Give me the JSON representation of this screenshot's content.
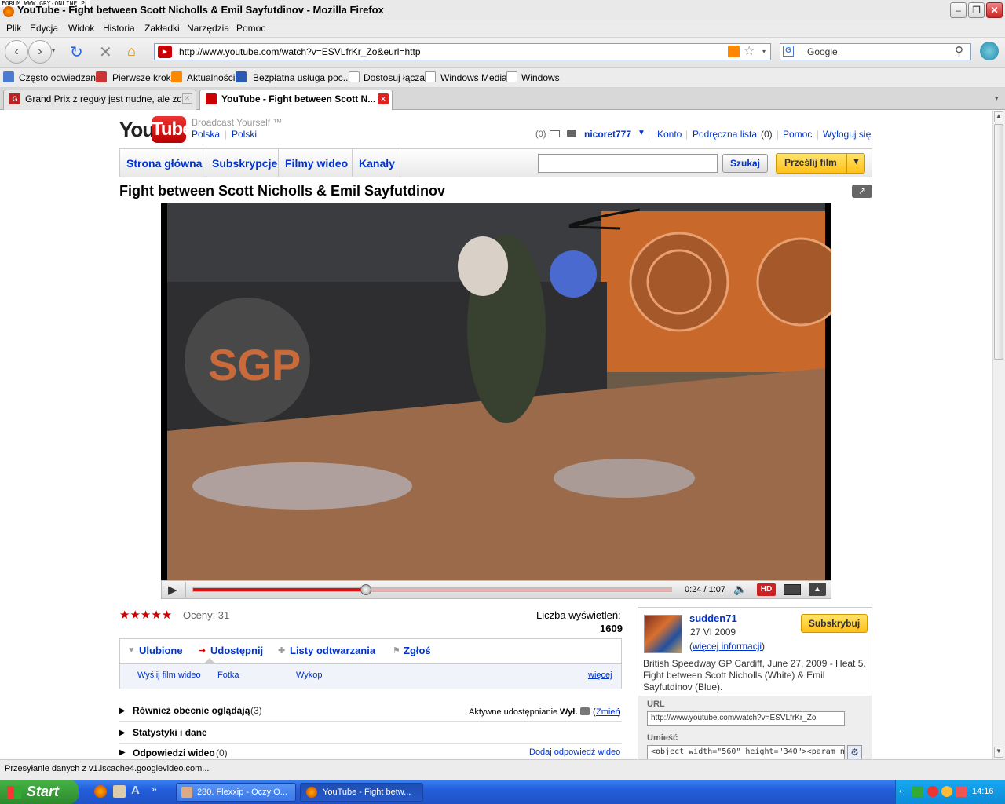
{
  "window": {
    "forum_tag": "FORUM WWW.GRY-ONLINE.PL",
    "title": "YouTube - Fight between Scott Nicholls & Emil Sayfutdinov - Mozilla Firefox"
  },
  "menu": [
    "Plik",
    "Edycja",
    "Widok",
    "Historia",
    "Zakładki",
    "Narzędzia",
    "Pomoc"
  ],
  "navbar": {
    "url": "http://www.youtube.com/watch?v=ESVLfrKr_Zo&eurl=http",
    "search_placeholder": "Google"
  },
  "bookmarks": [
    "Często odwiedzane",
    "Pierwsze kroki",
    "Aktualności",
    "Bezpłatna usługa poc...",
    "Dostosuj łącza",
    "Windows Media",
    "Windows"
  ],
  "tabs": [
    {
      "label": "Grand Prix z reguły jest nudne, ale zdarz..."
    },
    {
      "label": "YouTube - Fight between Scott N..."
    }
  ],
  "yt": {
    "logo_you": "You",
    "logo_tube": "Tube",
    "tagline": "Broadcast Yourself ™",
    "region": "Polska",
    "language": "Polski",
    "user": {
      "msg_count": "(0)",
      "username": "nicoret777",
      "account": "Konto",
      "quicklist": "Podręczna lista",
      "quicklist_count": "(0)",
      "help": "Pomoc",
      "logout": "Wyloguj się"
    },
    "nav": [
      "Strona główna",
      "Subskrypcje",
      "Filmy wideo",
      "Kanały"
    ],
    "search_button": "Szukaj",
    "upload_button": "Prześlij film",
    "video_title": "Fight between Scott Nicholls & Emil Sayfutdinov",
    "player": {
      "time": "0:24 / 1:07",
      "progress_fraction": 0.36,
      "hd_label": "HD"
    },
    "ratings_label": "Oceny: 31",
    "views_label": "Liczba wyświetleń:",
    "views_count": "1609",
    "actions": [
      "Ulubione",
      "Udostępnij",
      "Listy odtwarzania",
      "Zgłoś"
    ],
    "share_sub": [
      "Wyślij film wideo",
      "Fotka",
      "Wykop"
    ],
    "more_link": "więcej",
    "sections": [
      {
        "title": "Również obecnie oglądają",
        "count": "(3)"
      },
      {
        "title": "Statystyki i dane",
        "count": ""
      },
      {
        "title": "Odpowiedzi wideo",
        "count": "(0)"
      }
    ],
    "active_share": "Aktywne udostępnianie",
    "active_share_state": "Wył.",
    "change_link": "Zmień",
    "add_response": "Dodaj odpowiedź wideo",
    "uploader": {
      "name": "sudden71",
      "date": "27 VI 2009",
      "more_info": "więcej informacji",
      "subscribe": "Subskrybuj",
      "description": "British Speedway GP Cardiff, June 27, 2009 - Heat 5. Fight between Scott Nicholls (White) & Emil Sayfutdinov (Blue).",
      "url_label": "URL",
      "url_value": "http://www.youtube.com/watch?v=ESVLfrKr_Zo",
      "embed_label": "Umieść",
      "embed_value": "<object width=\"560\" height=\"340\"><param name=\"n"
    }
  },
  "status": "Przesyłanie danych z v1.lscache4.googlevideo.com...",
  "taskbar": {
    "start": "Start",
    "items": [
      "280. Flexxip - Oczy O...",
      "YouTube - Fight betw..."
    ],
    "clock": "14:16"
  }
}
